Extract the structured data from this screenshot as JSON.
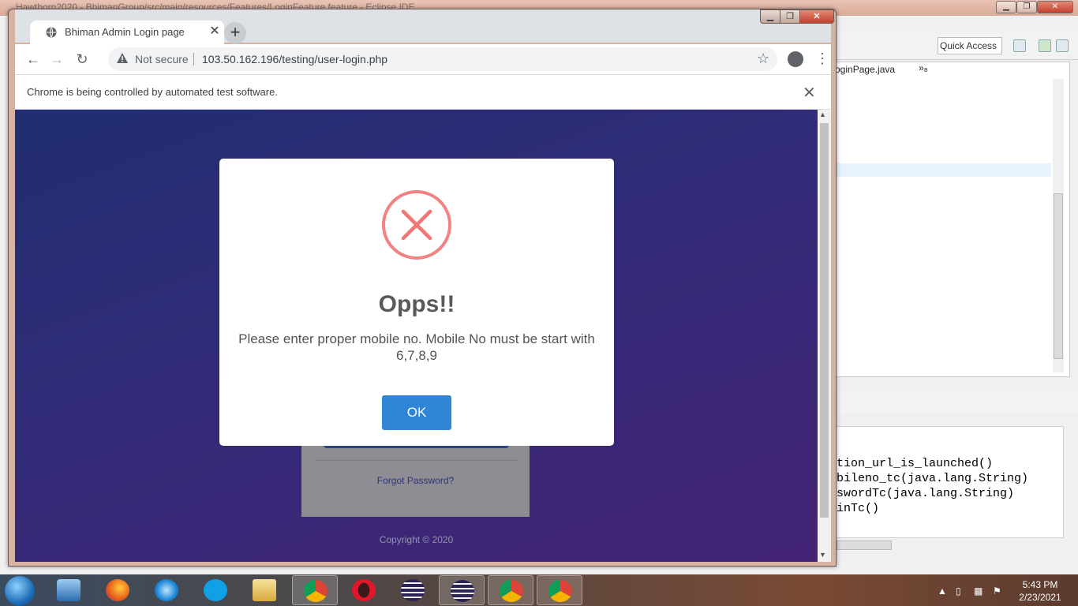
{
  "eclipse": {
    "title": "Hawthorn2020 - BhimanGroup/src/main/resources/Features/LoginFeature.feature - Eclipse IDE",
    "quick_access": "Quick Access",
    "editor_tab": "oginPage.java",
    "editor_more": "»₈",
    "console_lines": [
      "ation_url_is_launched()",
      "obileno_tc(java.lang.String)",
      "sswordTc(java.lang.String)",
      "ginTc()"
    ]
  },
  "browser": {
    "tab_title": "Bhiman Admin Login page",
    "tab_close": "✕",
    "new_tab": "+",
    "security_label": "Not secure",
    "url": "103.50.162.196/testing/user-login.php",
    "bookmark_icon": "star-icon",
    "infobar_text": "Chrome is being controlled by automated test software.",
    "infobar_close": "✕"
  },
  "page": {
    "forgot_password": "Forgot Password?",
    "copyright": "Copyright © 2020"
  },
  "dialog": {
    "icon": "error-x-icon",
    "title": "Opps!!",
    "message": "Please enter proper mobile no. Mobile No must be start with 6,7,8,9",
    "ok_label": "OK",
    "accent_color": "#f27474",
    "button_color": "#3085d6"
  },
  "taskbar": {
    "items": [
      "media-player-icon",
      "firefox-icon",
      "internet-explorer-icon",
      "skype-icon",
      "file-explorer-icon",
      "chrome-icon",
      "opera-icon",
      "eclipse-icon",
      "eclipse-icon",
      "chrome-icon",
      "chrome-icon"
    ],
    "time": "5:43 PM",
    "date": "2/23/2021"
  }
}
